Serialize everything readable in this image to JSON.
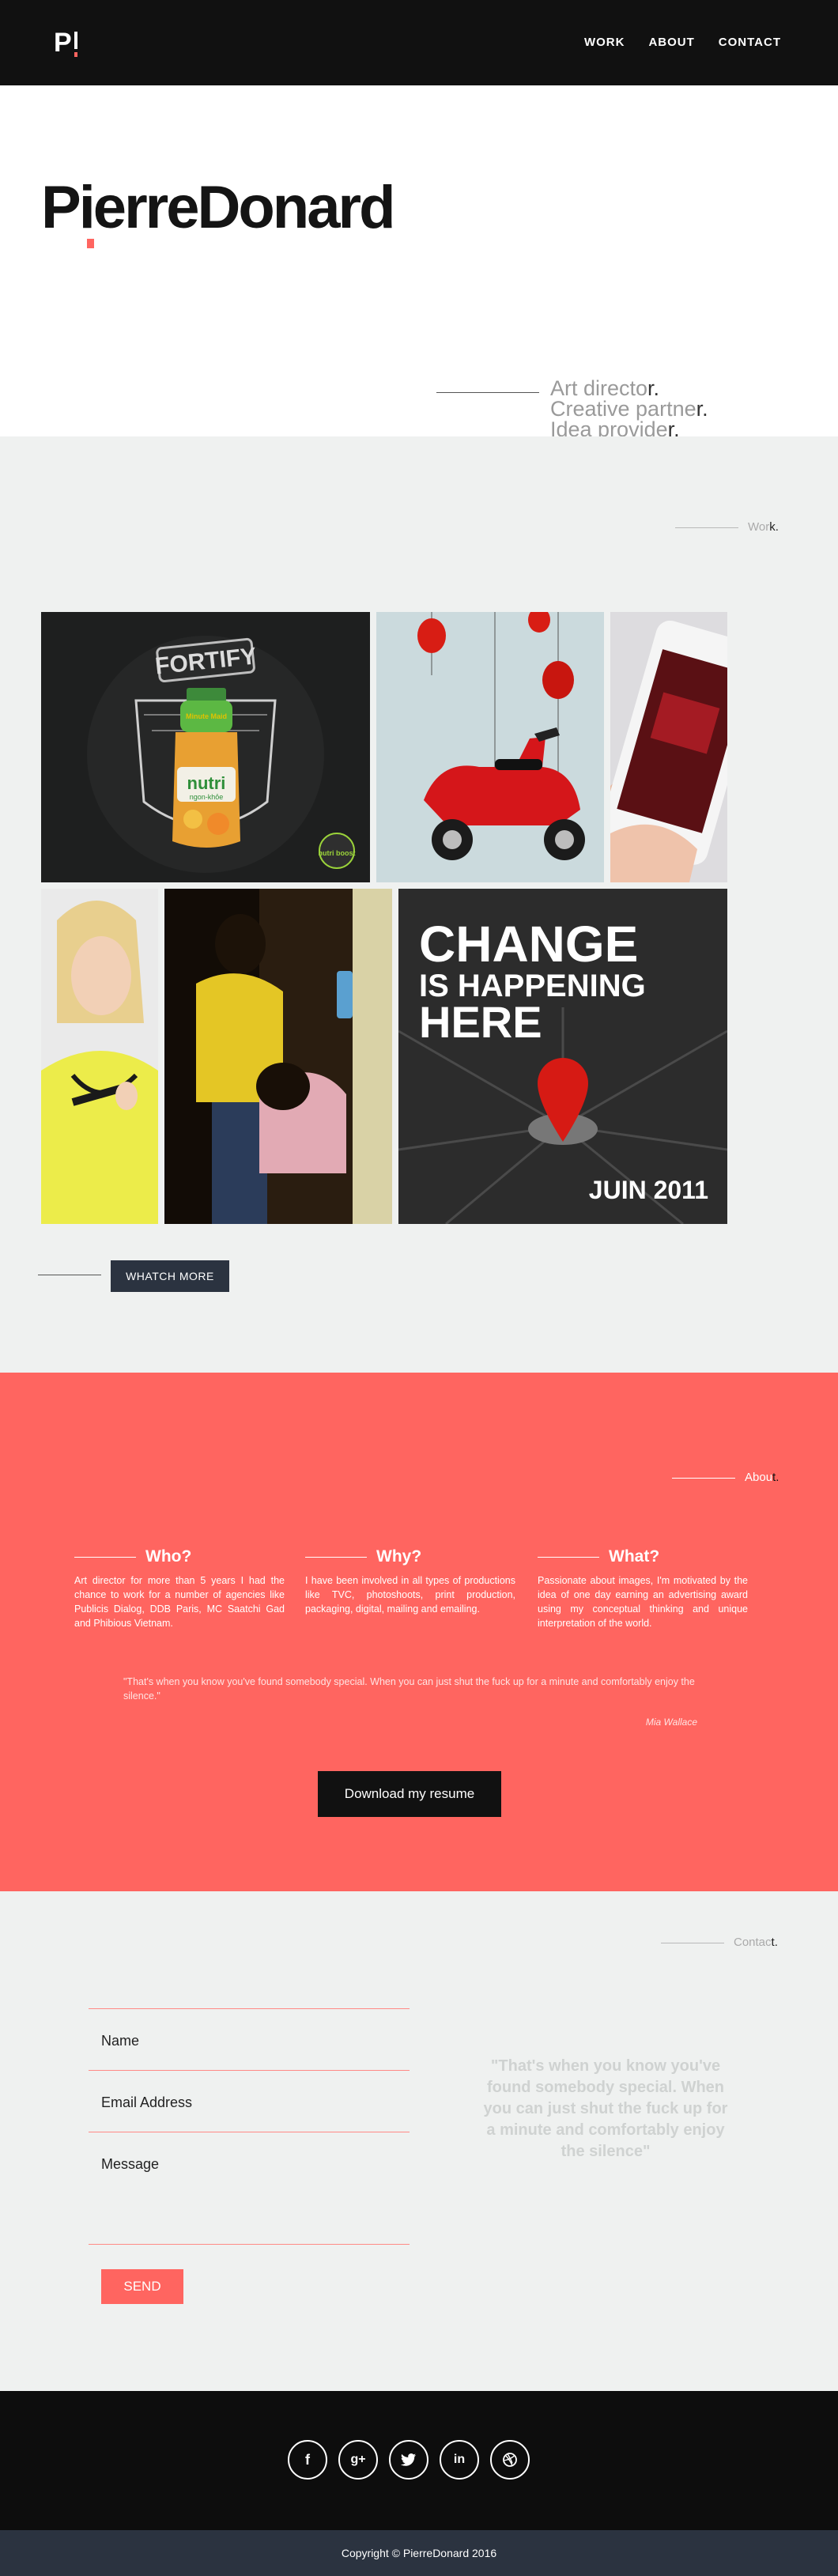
{
  "colors": {
    "accent": "#ff6560",
    "dark": "#111111",
    "navy": "#2b3340",
    "light_bg": "#eff1f0"
  },
  "header": {
    "logo_letter": "P",
    "nav": [
      "WORK",
      "ABOUT",
      "CONTACT"
    ]
  },
  "hero": {
    "wordmark": "PierreDonard",
    "taglines": [
      {
        "main": "Art directo",
        "last": "r."
      },
      {
        "main": "Creative partne",
        "last": "r."
      },
      {
        "main": "Idea provide",
        "last": "r."
      }
    ]
  },
  "work": {
    "label_main": "Wor",
    "label_last": "k.",
    "button": "WHATCH MORE",
    "tiles": [
      {
        "name": "fortify-tile",
        "texts": {
          "headline": "FORTIFY",
          "brand": "Minute Maid",
          "product": "nutri",
          "sub": "ngon-khỏe",
          "badge": "nutri boost"
        }
      },
      {
        "name": "vespa-tile"
      },
      {
        "name": "phone-tile"
      },
      {
        "name": "woman-yellow-tile"
      },
      {
        "name": "hair-salon-tile"
      },
      {
        "name": "change-poster-tile",
        "texts": {
          "line1": "CHANGE",
          "line2": "IS HAPPENING",
          "line3": "HERE",
          "date": "JUIN 2011"
        }
      }
    ]
  },
  "about": {
    "label_main": "Abou",
    "label_last": "t.",
    "columns": [
      {
        "title": "Who?",
        "body": "Art director for more than 5 years I had the chance to work for a number of agencies like Publicis Dialog, DDB Paris, MC Saatchi Gad and Phibious Vietnam."
      },
      {
        "title": "Why?",
        "body": "I have been involved in all types of productions like TVC, photoshoots, print production, packaging, digital, mailing and emailing."
      },
      {
        "title": "What?",
        "body": "Passionate about images, I'm motivated by the idea of one day earning an advertising award using my conceptual thinking and unique interpretation of the world."
      }
    ],
    "quote": "\"That's when you know you've found somebody special. When you can just shut the fuck up for a minute and comfortably enjoy the silence.\"",
    "quote_author": "Mia Wallace",
    "resume_button": "Download my resume"
  },
  "contact": {
    "label_main": "Contac",
    "label_last": "t.",
    "fields": [
      "Name",
      "Email Address",
      "Message"
    ],
    "send": "SEND",
    "quote": "\"That's when you know you've found somebody special. When you can just shut the fuck up for a minute and comfortably enjoy the silence\""
  },
  "footer": {
    "social_icons": [
      "facebook-icon",
      "google-plus-icon",
      "twitter-icon",
      "linkedin-icon",
      "dribbble-icon"
    ],
    "social_glyphs": [
      "f",
      "g+",
      "🐦",
      "in",
      "◎"
    ],
    "copyright": "Copyright © PierreDonard 2016"
  }
}
